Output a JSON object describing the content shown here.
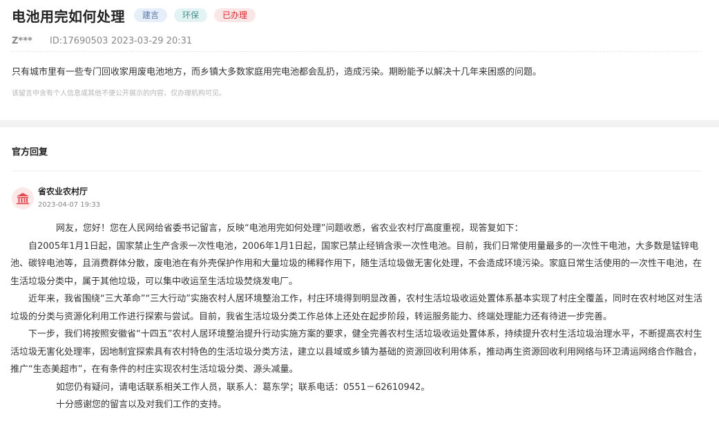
{
  "post": {
    "title": "电池用完如何处理",
    "tags": [
      {
        "label": "建言"
      },
      {
        "label": "环保"
      },
      {
        "label": "已办理"
      }
    ],
    "user": "Z***",
    "id_text": "ID:17690503",
    "datetime": "2023-03-29 20:31",
    "content": "只有城市里有一些专门回收家用废电池地方，而乡镇大多数家庭用完电池都会乱扔，造成污染。期盼能予以解决十几年来困惑的问题。",
    "privacy_note": "该留言中含有个人信息或其他不便公开展示的内容，仅办理机构可见。"
  },
  "reply": {
    "heading": "官方回复",
    "org_name": "省农业农村厅",
    "org_date": "2023-04-07 19:33",
    "paragraphs": [
      "网友，您好！您在人民网给省委书记留言，反映“电池用完如何处理”问题收悉，省农业农村厅高度重视，现答复如下：",
      "自2005年1月1日起，国家禁止生产含汞一次性电池，2006年1月1日起，国家已禁止经销含汞一次性电池。目前，我们日常使用量最多的一次性干电池，大多数是锰锌电池、碳锌电池等，且消费群体分散，废电池在有外壳保护作用和大量垃圾的稀释作用下，随生活垃圾做无害化处理，不会造成环境污染。家庭日常生活使用的一次性干电池，在生活垃圾分类中，属于其他垃圾，可以集中收运至生活垃圾焚烧发电厂。",
      "近年来，我省围绕“三大革命”“三大行动”实施农村人居环境整治工作，村庄环境得到明显改善，农村生活垃圾收运处置体系基本实现了村庄全覆盖，同时在农村地区对生活垃圾的分类与资源化利用工作进行探索与尝试。目前，我省生活垃圾分类工作总体上还处在起步阶段，转运服务能力、终端处理能力还有待进一步完善。",
      "下一步，我们将按照安徽省“十四五”农村人居环境整治提升行动实施方案的要求，健全完善农村生活垃圾收运处置体系，持续提升农村生活垃圾治理水平，不断提高农村生活垃圾无害化处理率，因地制宜探索具有农村特色的生活垃圾分类方法，建立以县域或乡镇为基础的资源回收利用体系，推动再生资源回收利用网络与环卫清运网络合作融合，推广“生态美超市”，在有条件的村庄实现农村生活垃圾分类、源头减量。",
      "如您仍有疑问，请电话联系相关工作人员，联系人：葛东学；联系电话：0551－62610942。",
      "十分感谢您的留言以及对我们工作的支持。"
    ]
  },
  "icons": {
    "org_avatar": "government-building-icon"
  },
  "colors": {
    "tag_blue_bg": "#e6eef9",
    "tag_teal_bg": "#e3f3f3",
    "tag_red_bg": "#fbe6e7",
    "tag_red_text": "#d8262e",
    "avatar_bg": "#fbe9ea",
    "avatar_icon": "#e24a52"
  }
}
